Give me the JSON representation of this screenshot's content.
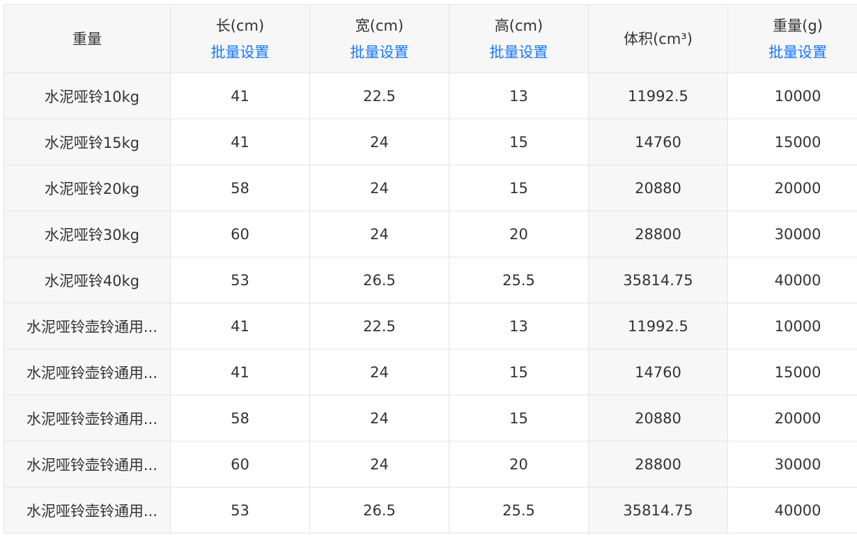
{
  "table": {
    "headers": [
      {
        "title": "重量",
        "link": null
      },
      {
        "title": "长(cm)",
        "link": "批量设置"
      },
      {
        "title": "宽(cm)",
        "link": "批量设置"
      },
      {
        "title": "高(cm)",
        "link": "批量设置"
      },
      {
        "title": "体积(cm³)",
        "link": null
      },
      {
        "title": "重量(g)",
        "link": "批量设置"
      }
    ],
    "rows": [
      {
        "name": "水泥哑铃10kg",
        "length": "41",
        "width": "22.5",
        "height": "13",
        "volume": "11992.5",
        "weight": "10000"
      },
      {
        "name": "水泥哑铃15kg",
        "length": "41",
        "width": "24",
        "height": "15",
        "volume": "14760",
        "weight": "15000"
      },
      {
        "name": "水泥哑铃20kg",
        "length": "58",
        "width": "24",
        "height": "15",
        "volume": "20880",
        "weight": "20000"
      },
      {
        "name": "水泥哑铃30kg",
        "length": "60",
        "width": "24",
        "height": "20",
        "volume": "28800",
        "weight": "30000"
      },
      {
        "name": "水泥哑铃40kg",
        "length": "53",
        "width": "26.5",
        "height": "25.5",
        "volume": "35814.75",
        "weight": "40000"
      },
      {
        "name": "水泥哑铃壶铃通用...",
        "length": "41",
        "width": "22.5",
        "height": "13",
        "volume": "11992.5",
        "weight": "10000"
      },
      {
        "name": "水泥哑铃壶铃通用...",
        "length": "41",
        "width": "24",
        "height": "15",
        "volume": "14760",
        "weight": "15000"
      },
      {
        "name": "水泥哑铃壶铃通用...",
        "length": "58",
        "width": "24",
        "height": "15",
        "volume": "20880",
        "weight": "20000"
      },
      {
        "name": "水泥哑铃壶铃通用...",
        "length": "60",
        "width": "24",
        "height": "20",
        "volume": "28800",
        "weight": "30000"
      },
      {
        "name": "水泥哑铃壶铃通用...",
        "length": "53",
        "width": "26.5",
        "height": "25.5",
        "volume": "35814.75",
        "weight": "40000"
      }
    ]
  },
  "colors": {
    "link": "#1677ff",
    "header_bg": "#f7f7f7",
    "border": "#e4e4e4",
    "text": "#333333"
  }
}
